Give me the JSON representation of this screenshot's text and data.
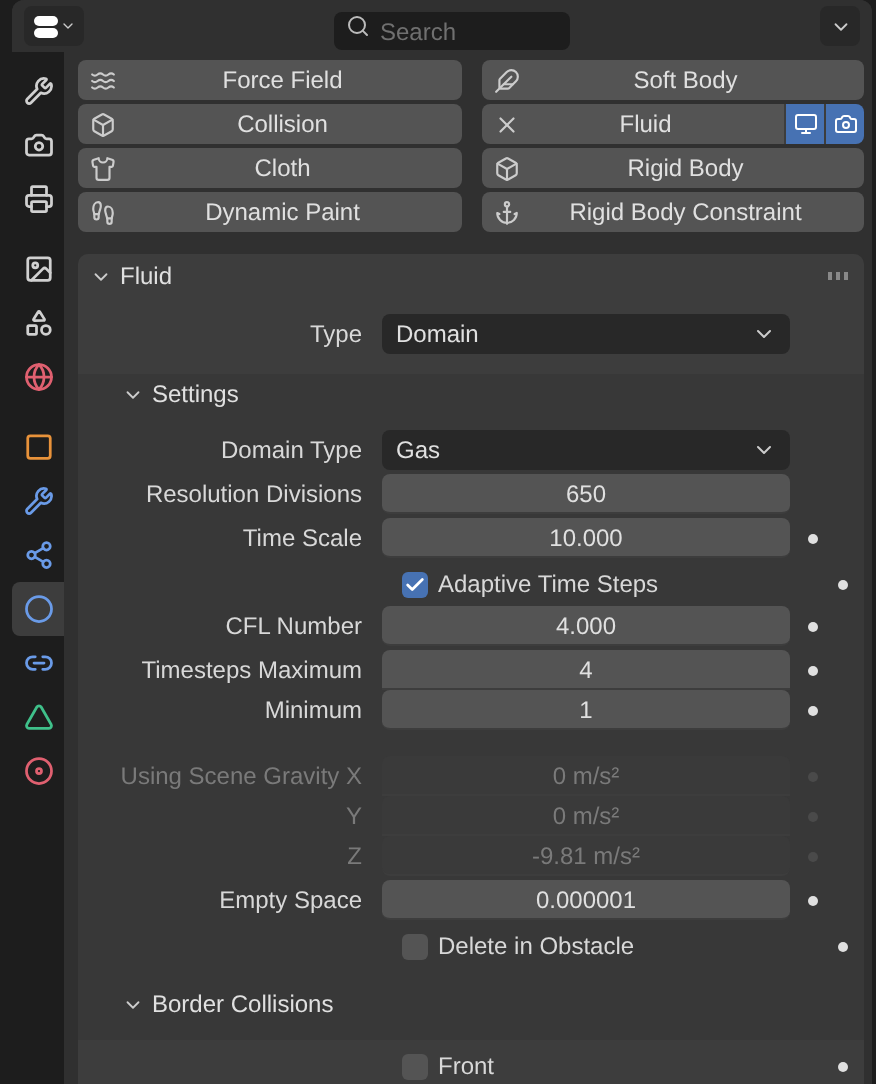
{
  "header": {
    "search": {
      "placeholder": "Search"
    }
  },
  "sidebar": {
    "tabs": [
      {
        "kind": "tool",
        "selected": false
      },
      {
        "kind": "render",
        "selected": false
      },
      {
        "kind": "output",
        "selected": false
      },
      {
        "kind": "view-layer",
        "selected": false
      },
      {
        "kind": "scene",
        "selected": false
      },
      {
        "kind": "world",
        "selected": false
      },
      {
        "kind": "object",
        "selected": false
      },
      {
        "kind": "modifier",
        "selected": false
      },
      {
        "kind": "particles",
        "selected": false
      },
      {
        "kind": "physics",
        "selected": true
      },
      {
        "kind": "constraints",
        "selected": false
      },
      {
        "kind": "data",
        "selected": false
      },
      {
        "kind": "material",
        "selected": false
      }
    ]
  },
  "physics_buttons": [
    {
      "label": "Force Field",
      "enabled": false
    },
    {
      "label": "Soft Body",
      "enabled": false
    },
    {
      "label": "Collision",
      "enabled": false
    },
    {
      "label": "Fluid",
      "enabled": true,
      "viewport": true,
      "render": true
    },
    {
      "label": "Cloth",
      "enabled": false
    },
    {
      "label": "Rigid Body",
      "enabled": false
    },
    {
      "label": "Dynamic Paint",
      "enabled": false
    },
    {
      "label": "Rigid Body Constraint",
      "enabled": false
    }
  ],
  "fluid_panel": {
    "title": "Fluid",
    "expanded": true,
    "type": {
      "label": "Type",
      "value": "Domain"
    },
    "settings": {
      "title": "Settings",
      "expanded": true,
      "rows": [
        {
          "kind": "dropdown",
          "label": "Domain Type",
          "value": "Gas",
          "disabled": false,
          "animatable": false
        },
        {
          "kind": "number",
          "label": "Resolution Divisions",
          "value": "650",
          "disabled": false,
          "animatable": false
        },
        {
          "kind": "number",
          "label": "Time Scale",
          "value": "10.000",
          "disabled": false,
          "animatable": true
        },
        {
          "kind": "checkbox",
          "label": "Adaptive Time Steps",
          "checked": true,
          "disabled": false,
          "animatable": true
        },
        {
          "kind": "number",
          "label": "CFL Number",
          "value": "4.000",
          "disabled": false,
          "animatable": true
        },
        {
          "kind": "number",
          "label": "Timesteps Maximum",
          "value": "4",
          "disabled": false,
          "animatable": true,
          "joined": true
        },
        {
          "kind": "number",
          "label": "Minimum",
          "value": "1",
          "disabled": false,
          "animatable": true
        },
        {
          "kind": "number",
          "label": "Using Scene Gravity X",
          "value": "0 m/s²",
          "disabled": true,
          "animatable": true,
          "gap": true,
          "joined": true
        },
        {
          "kind": "number",
          "label": "Y",
          "value": "0 m/s²",
          "disabled": true,
          "animatable": true,
          "joined": true
        },
        {
          "kind": "number",
          "label": "Z",
          "value": "-9.81 m/s²",
          "disabled": true,
          "animatable": true
        },
        {
          "kind": "number",
          "label": "Empty Space",
          "value": "0.000001",
          "disabled": false,
          "animatable": true
        },
        {
          "kind": "checkbox",
          "label": "Delete in Obstacle",
          "checked": false,
          "disabled": false,
          "animatable": true
        }
      ]
    },
    "border_collisions": {
      "title": "Border Collisions",
      "expanded": true,
      "rows": [
        {
          "kind": "checkbox",
          "label": "Front",
          "checked": false,
          "disabled": false,
          "animatable": true
        }
      ]
    }
  }
}
